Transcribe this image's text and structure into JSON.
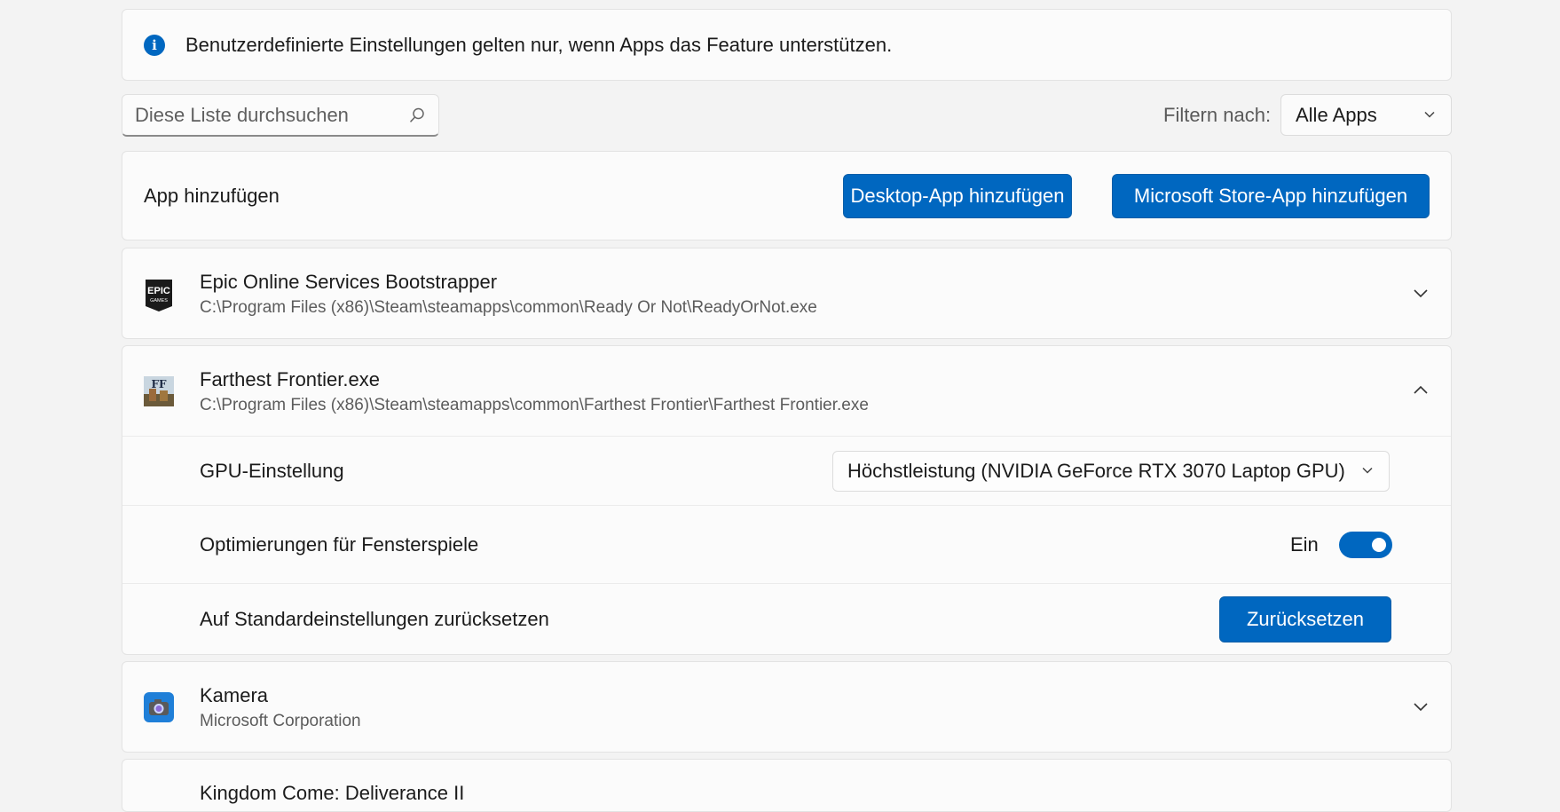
{
  "info": {
    "text": "Benutzerdefinierte Einstellungen gelten nur, wenn Apps das Feature unterstützen.",
    "icon": "info-icon"
  },
  "search": {
    "placeholder": "Diese Liste durchsuchen"
  },
  "filter": {
    "label": "Filtern nach:",
    "value": "Alle Apps"
  },
  "add_app": {
    "label": "App hinzufügen",
    "desktop_button": "Desktop-App hinzufügen",
    "store_button": "Microsoft Store-App hinzufügen"
  },
  "apps": [
    {
      "name": "Epic Online Services Bootstrapper",
      "path": "C:\\Program Files (x86)\\Steam\\steamapps\\common\\Ready Or Not\\ReadyOrNot.exe",
      "expanded": false,
      "icon": "epic-games-icon"
    },
    {
      "name": "Farthest Frontier.exe",
      "path": "C:\\Program Files (x86)\\Steam\\steamapps\\common\\Farthest Frontier\\Farthest Frontier.exe",
      "expanded": true,
      "icon": "farthest-frontier-icon"
    },
    {
      "name": "Kamera",
      "path": "Microsoft Corporation",
      "expanded": false,
      "icon": "camera-icon"
    }
  ],
  "expanded_settings": {
    "gpu_label": "GPU-Einstellung",
    "gpu_value": "Höchstleistung (NVIDIA GeForce RTX 3070 Laptop GPU)",
    "windowed_label": "Optimierungen für Fensterspiele",
    "windowed_state": "Ein",
    "reset_label": "Auf Standardeinstellungen zurücksetzen",
    "reset_button": "Zurücksetzen"
  },
  "next_app_partial": "Kingdom Come: Deliverance II",
  "colors": {
    "accent": "#0067c0",
    "background": "#f3f3f3",
    "card": "#fbfbfb"
  }
}
